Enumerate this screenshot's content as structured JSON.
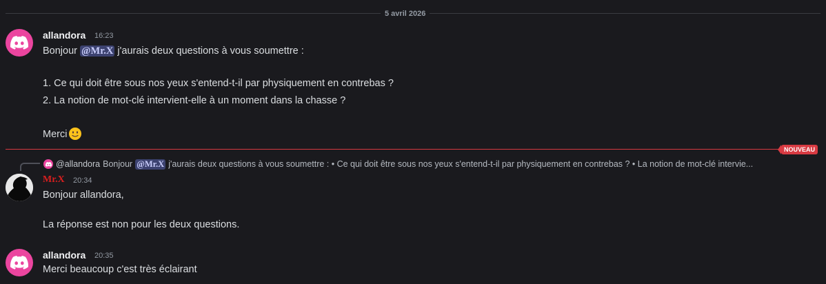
{
  "date_divider": "5 avril 2026",
  "new_badge": "NOUVEAU",
  "messages": [
    {
      "author": "allandora",
      "time": "16:23",
      "lines": {
        "l1_pre": "Bonjour",
        "l1_mention": "@Mr.X",
        "l1_post": "j'aurais deux questions à vous soumettre :",
        "l2": "1. Ce qui doit être sous nos yeux s'entend-t-il par physiquement en contrebas ?",
        "l3": "2. La notion de mot-clé intervient-elle à un moment dans la chasse ?",
        "l4": "Merci"
      },
      "emoji": "slightly-smiling-face"
    },
    {
      "reply_to": {
        "user": "@allandora",
        "pre": "Bonjour",
        "mention": "@Mr.X",
        "text": "j'aurais deux questions à vous soumettre :  • Ce qui doit être sous nos yeux s'entend-t-il par physiquement en contrebas ?  • La notion de mot-clé intervie..."
      },
      "author": "Mr.X",
      "time": "20:34",
      "lines": {
        "l1": "Bonjour allandora,",
        "l2": "La réponse est non pour les deux questions."
      }
    },
    {
      "author": "allandora",
      "time": "20:35",
      "lines": {
        "l1": "Merci beaucoup c'est très éclairant"
      }
    }
  ],
  "colors": {
    "background": "#1a1a1e",
    "discord_avatar": "#eb459f",
    "mention_bg": "#3c4270",
    "new_divider": "#d83a42",
    "mrx_name": "#d91f1f"
  }
}
